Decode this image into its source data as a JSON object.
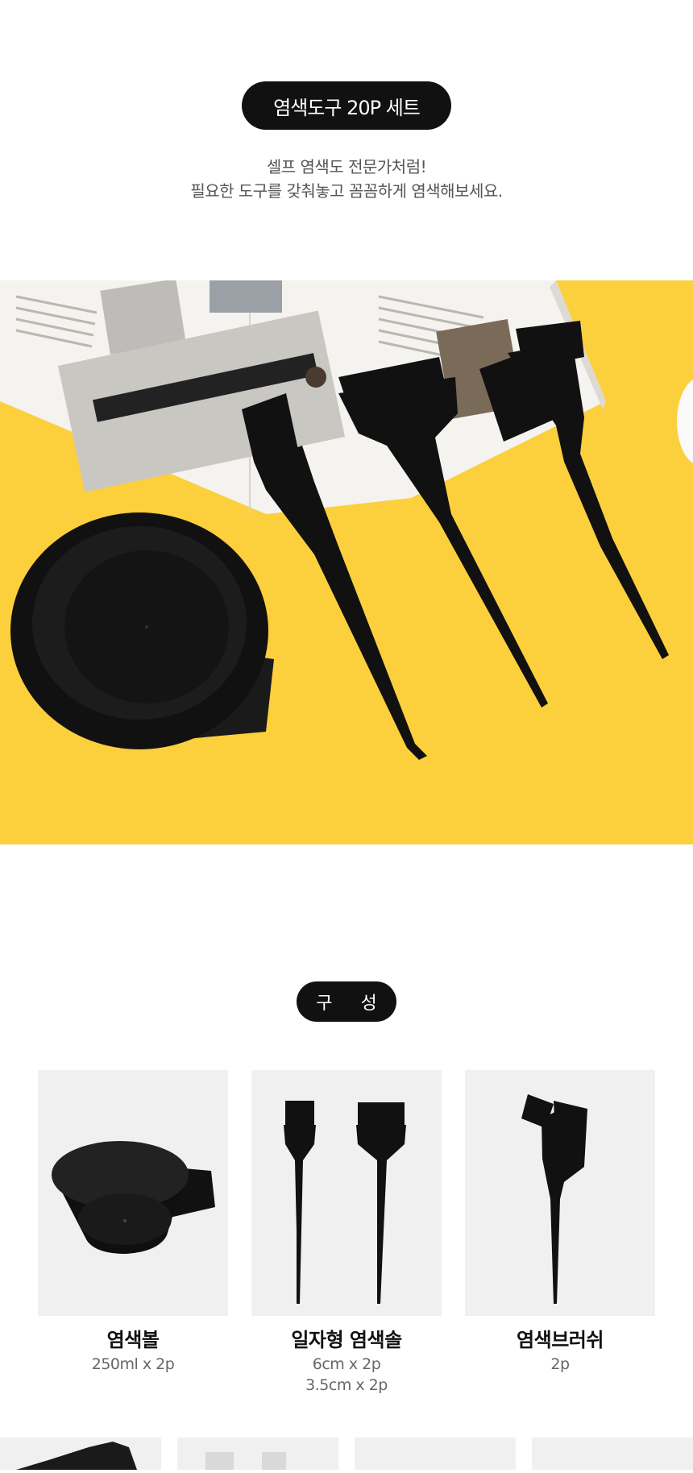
{
  "header": {
    "title": "염색도구 20P 세트",
    "subtitle_line1": "셀프 염색도 전문가처럼!",
    "subtitle_line2": "필요한 도구를 갖춰놓고 꼼꼼하게 염색해보세요."
  },
  "hero": {
    "background_color": "#fccf3d"
  },
  "composition": {
    "title": "구 성",
    "items": [
      {
        "name": "염색볼",
        "spec_lines": [
          "250ml x 2p"
        ],
        "icon": "dye-bowl-icon"
      },
      {
        "name": "일자형 염색솔",
        "spec_lines": [
          "6cm x 2p",
          "3.5cm x 2p"
        ],
        "icon": "flat-dye-brush-icon"
      },
      {
        "name": "염색브러쉬",
        "spec_lines": [
          "2p"
        ],
        "icon": "comb-brush-icon"
      }
    ]
  }
}
